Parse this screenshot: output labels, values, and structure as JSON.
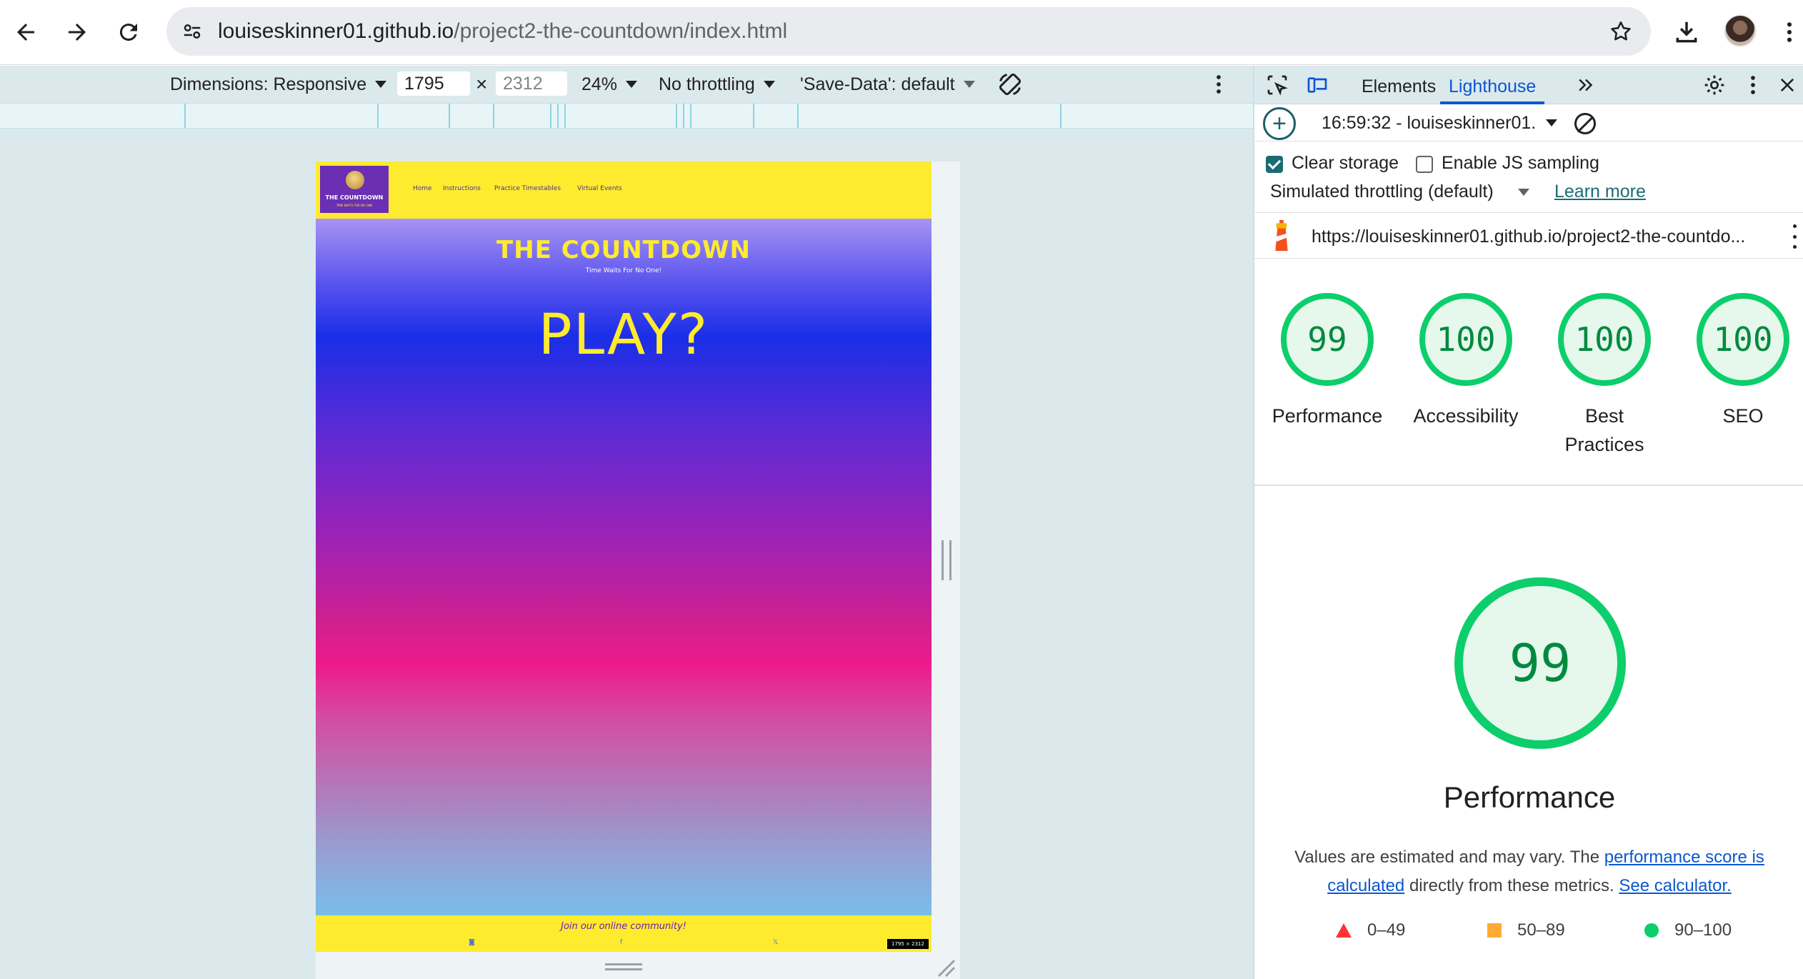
{
  "browser": {
    "url_host": "louiseskinner01.github.io",
    "url_path": "/project2-the-countdown/index.html"
  },
  "device_toolbar": {
    "dimensions_label": "Dimensions: Responsive",
    "width": "1795",
    "height": "2312",
    "zoom": "24%",
    "throttling": "No throttling",
    "save_data": "'Save-Data': default"
  },
  "site": {
    "logo_title": "THE COUNTDOWN",
    "logo_sub": "TIME WAITS FOR NO ONE",
    "nav": [
      "Home",
      "Instructions",
      "Practice Timestables",
      "Virtual Events"
    ],
    "hero_title": "THE COUNTDOWN",
    "hero_subtitle": "Time Waits For No One!",
    "play": "PLAY?",
    "footer_text": "Join our online community!",
    "social": [
      "◙",
      "f",
      "𝕏"
    ],
    "dims_badge": "1795 × 2312"
  },
  "devtools": {
    "tabs": [
      "Elements",
      "Lighthouse"
    ],
    "report_select": "16:59:32 - louiseskinner01.",
    "clear_storage": "Clear storage",
    "clear_storage_checked": true,
    "js_sampling": "Enable JS sampling",
    "js_sampling_checked": false,
    "throttling": "Simulated throttling (default)",
    "learn_more": "Learn more",
    "audited_url": "https://louiseskinner01.github.io/project2-the-countdo...",
    "scores": [
      {
        "value": "99",
        "label": "Performance"
      },
      {
        "value": "100",
        "label": "Accessibility"
      },
      {
        "value": "100",
        "label": "Best Practices"
      },
      {
        "value": "100",
        "label": "SEO"
      }
    ],
    "big_score": "99",
    "big_title": "Performance",
    "note_pre": "Values are estimated and may vary. The ",
    "note_link1": "performance score is calculated",
    "note_mid": " directly from these metrics. ",
    "note_link2": "See calculator.",
    "legend": [
      "0–49",
      "50–89",
      "90–100"
    ],
    "colors": {
      "pass": "#0cce6b",
      "average": "#ffaa33",
      "fail": "#ff3333",
      "accent": "#0b57d0"
    }
  }
}
